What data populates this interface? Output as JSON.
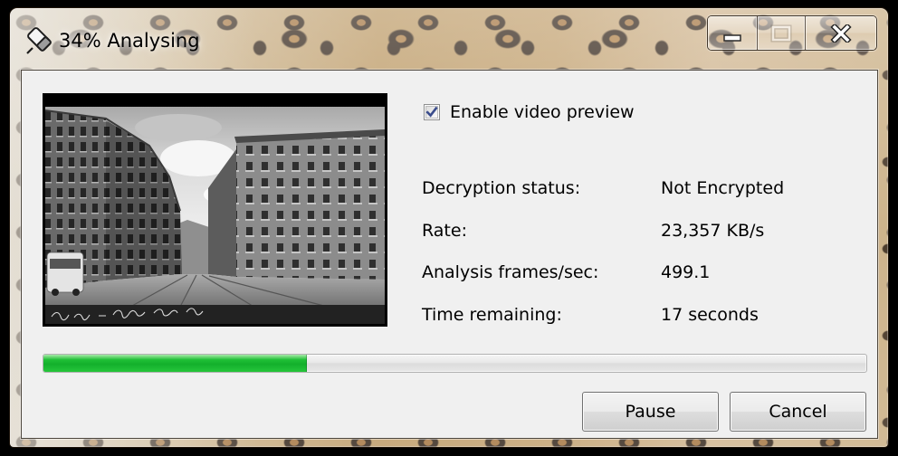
{
  "window": {
    "title": "34% Analysing",
    "app_icon": "app-icon",
    "minimize_icon": "minimize-icon",
    "maximize_icon": "maximize-icon",
    "maximize_enabled": false,
    "close_icon": "close-icon"
  },
  "preview_option": {
    "label": "Enable video preview",
    "checked": true,
    "check_icon": "checkmark-icon"
  },
  "stats": [
    {
      "label": "Decryption status:",
      "value": "Not Encrypted"
    },
    {
      "label": "Rate:",
      "value": "23,357 KB/s"
    },
    {
      "label": "Analysis frames/sec:",
      "value": "499.1"
    },
    {
      "label": "Time remaining:",
      "value": "17 seconds"
    }
  ],
  "progress": {
    "fill_fraction": 0.32
  },
  "buttons": {
    "pause_label": "Pause",
    "cancel_label": "Cancel"
  },
  "colors": {
    "client_background": "#f0f0f0",
    "progress_fill": "#1fbf35",
    "checkmark": "#3a4c8c",
    "text": "#000000"
  }
}
